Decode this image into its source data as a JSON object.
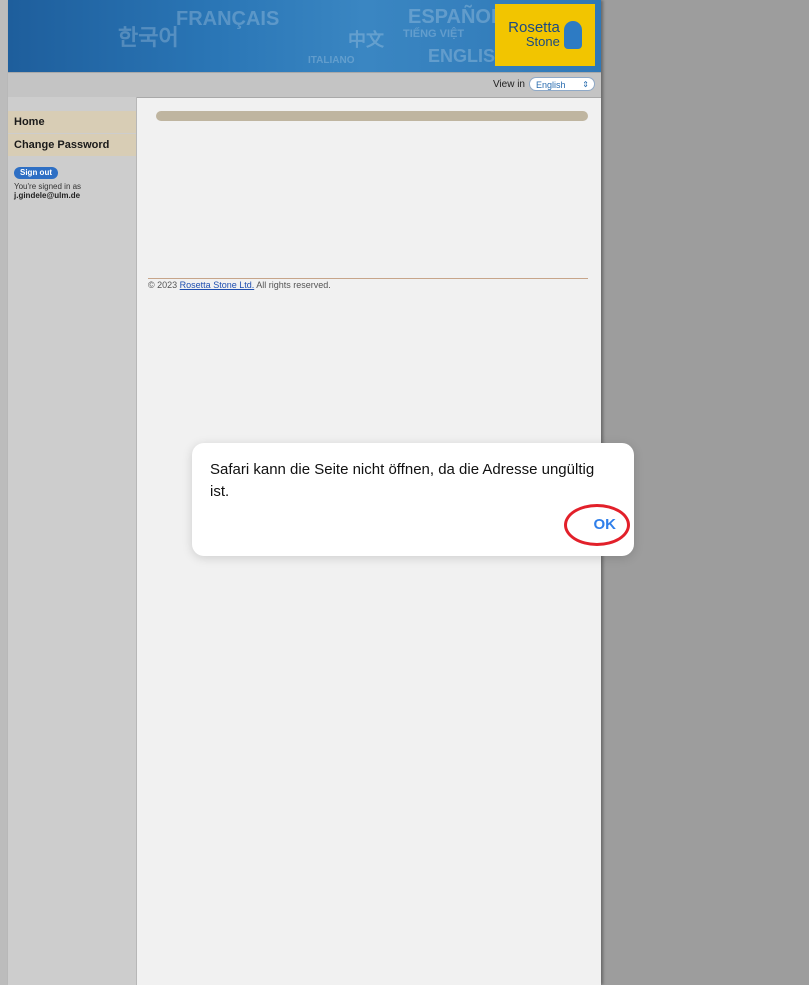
{
  "header": {
    "bg_words": [
      "FRANÇAIS",
      "ESPAÑOL",
      "TIẾNG VIỆT",
      "ENGLISH",
      "ITALIANO",
      "中文",
      "한국어"
    ],
    "logo": {
      "line1": "Rosetta",
      "line2": "Stone"
    },
    "view_in_label": "View in",
    "language": "English"
  },
  "sidebar": {
    "items": [
      {
        "label": "Home"
      },
      {
        "label": "Change Password"
      }
    ],
    "sign_out": "Sign out",
    "signed_in_as": "You're signed in as",
    "email": "j.gindele@ulm.de"
  },
  "footer": {
    "copyright": "© 2023",
    "link": "Rosetta Stone Ltd.",
    "rest": "All rights reserved."
  },
  "dialog": {
    "message": "Safari kann die Seite nicht öffnen, da die Adresse ungültig ist.",
    "ok_label": "OK"
  },
  "colors": {
    "accent": "#2f7fea",
    "highlight_circle": "#e2202a",
    "logo_bg": "#f2c500"
  }
}
